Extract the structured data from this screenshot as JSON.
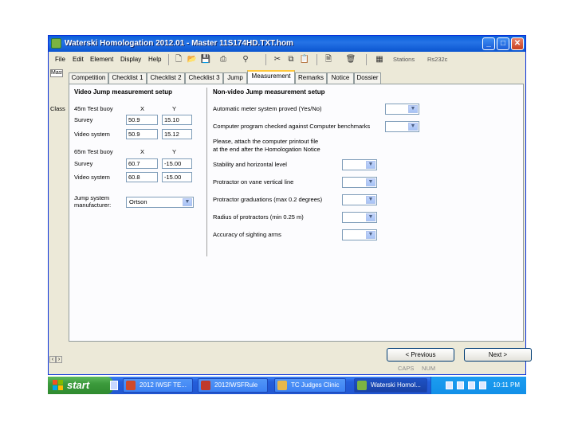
{
  "window": {
    "title": "Waterski Homologation 2012.01 - Master 11S174HD.TXT.hom",
    "buttons": {
      "minimize": "_",
      "maximize": "□",
      "close": "✕"
    }
  },
  "menu": {
    "items": [
      "File",
      "Edit",
      "Element",
      "Display",
      "Help"
    ],
    "toolbar_text": {
      "stations": "Stations",
      "port": "Rs232c"
    }
  },
  "left_strip": {
    "tab": "Mast",
    "label": "Class"
  },
  "tabs": [
    {
      "label": "Competition",
      "active": false
    },
    {
      "label": "Checklist 1",
      "active": false
    },
    {
      "label": "Checklist 2",
      "active": false
    },
    {
      "label": "Checklist 3",
      "active": false
    },
    {
      "label": "Jump",
      "active": false
    },
    {
      "label": "Measurement",
      "active": true
    },
    {
      "label": "Remarks",
      "active": false
    },
    {
      "label": "Notice",
      "active": false
    },
    {
      "label": "Dossier",
      "active": false
    }
  ],
  "video_setup": {
    "heading": "Video Jump measurement setup",
    "buoy45": {
      "label": "45m Test buoy",
      "x_label": "X",
      "y_label": "Y"
    },
    "survey1": {
      "label": "Survey",
      "x": "50.9",
      "y": "15.10"
    },
    "video1": {
      "label": "Video system",
      "x": "50.9",
      "y": "15.12"
    },
    "buoy65": {
      "label": "65m Test buoy",
      "x_label": "X",
      "y_label": "Y"
    },
    "survey2": {
      "label": "Survey",
      "x": "60.7",
      "y": "-15.00"
    },
    "video2": {
      "label": "Video system",
      "x": "60.8",
      "y": "-15.00"
    },
    "manufacturer": {
      "label_line1": "Jump system",
      "label_line2": "manufacturer:",
      "value": "Ortson"
    }
  },
  "nonvideo_setup": {
    "heading": "Non-video Jump measurement setup",
    "q1": "Automatic meter system proved (Yes/No)",
    "q2": "Computer program checked against Computer benchmarks",
    "q3_line1": "Please, attach the computer printout file",
    "q3_line2": "at the end after the Homologation Notice",
    "q4": "Stability and horizontal level",
    "q5": "Protractor on vane vertical line",
    "q6": "Protractor graduations (max 0.2 degrees)",
    "q7": "Radius of protractors (min 0.25 m)",
    "q8": "Accuracy of sighting arms"
  },
  "nav": {
    "previous": "< Previous",
    "next": "Next >"
  },
  "status": {
    "caps": "CAPS",
    "num": "NUM"
  },
  "taskbar": {
    "start": "start",
    "tasks": [
      {
        "label": "2012 IWSF TE...",
        "color": "#d04a2b"
      },
      {
        "label": "2012IWSFRule",
        "color": "#c0392b"
      },
      {
        "label": "TC Judges Clinic",
        "color": "#e8b84a"
      },
      {
        "label": "Waterski Homol...",
        "color": "#7cb342"
      }
    ],
    "clock": "10:11 PM"
  },
  "colors": {
    "accent": "#245edb",
    "tab_highlight": "#ffc83c",
    "start_green": "#3c9a3c"
  }
}
